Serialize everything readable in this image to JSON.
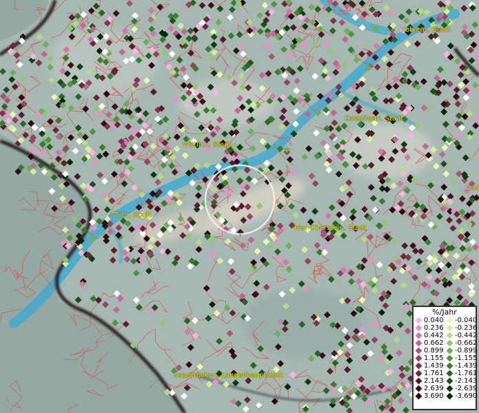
{
  "map": {
    "places": [
      {
        "name": "Koblenz, Stadt"
      },
      {
        "name": "Kastellaun, Stadt"
      },
      {
        "name": "Wittlich, Stadt"
      },
      {
        "name": "Trier, Stadt"
      },
      {
        "name": "Idar-Oberstein, Stadt"
      },
      {
        "name": "Saarbrücken, Landeshauptstadt"
      },
      {
        "name": "Bad"
      }
    ]
  },
  "legend": {
    "title": "%/Jahr",
    "positive": [
      {
        "label": "0.040",
        "color": "#f7b6e2"
      },
      {
        "label": "0.236",
        "color": "#e592c6"
      },
      {
        "label": "0.442",
        "color": "#d07aa8"
      },
      {
        "label": "0.662",
        "color": "#bd6a92"
      },
      {
        "label": "0.899",
        "color": "#a85578"
      },
      {
        "label": "1.155",
        "color": "#944460"
      },
      {
        "label": "1.439",
        "color": "#7f344b"
      },
      {
        "label": "1.761",
        "color": "#6a263a"
      },
      {
        "label": "2.143",
        "color": "#541a2b"
      },
      {
        "label": "2.639",
        "color": "#3d0f1d"
      },
      {
        "label": "3.690",
        "color": "#2a0710"
      }
    ],
    "negative": [
      {
        "label": "-0.040",
        "color": "#eaf7b0"
      },
      {
        "label": "-0.236",
        "color": "#d4eda0"
      },
      {
        "label": "-0.442",
        "color": "#b4dc88"
      },
      {
        "label": "-0.662",
        "color": "#92c672"
      },
      {
        "label": "-0.899",
        "color": "#6fad5a"
      },
      {
        "label": "-1.155",
        "color": "#4f9444"
      },
      {
        "label": "-1.439",
        "color": "#3a7c33"
      },
      {
        "label": "-1.761",
        "color": "#2a6526"
      },
      {
        "label": "-2.143",
        "color": "#1c4f1a"
      },
      {
        "label": "-2.639",
        "color": "#113a10"
      },
      {
        "label": "-3.690",
        "color": "#072607"
      }
    ]
  }
}
